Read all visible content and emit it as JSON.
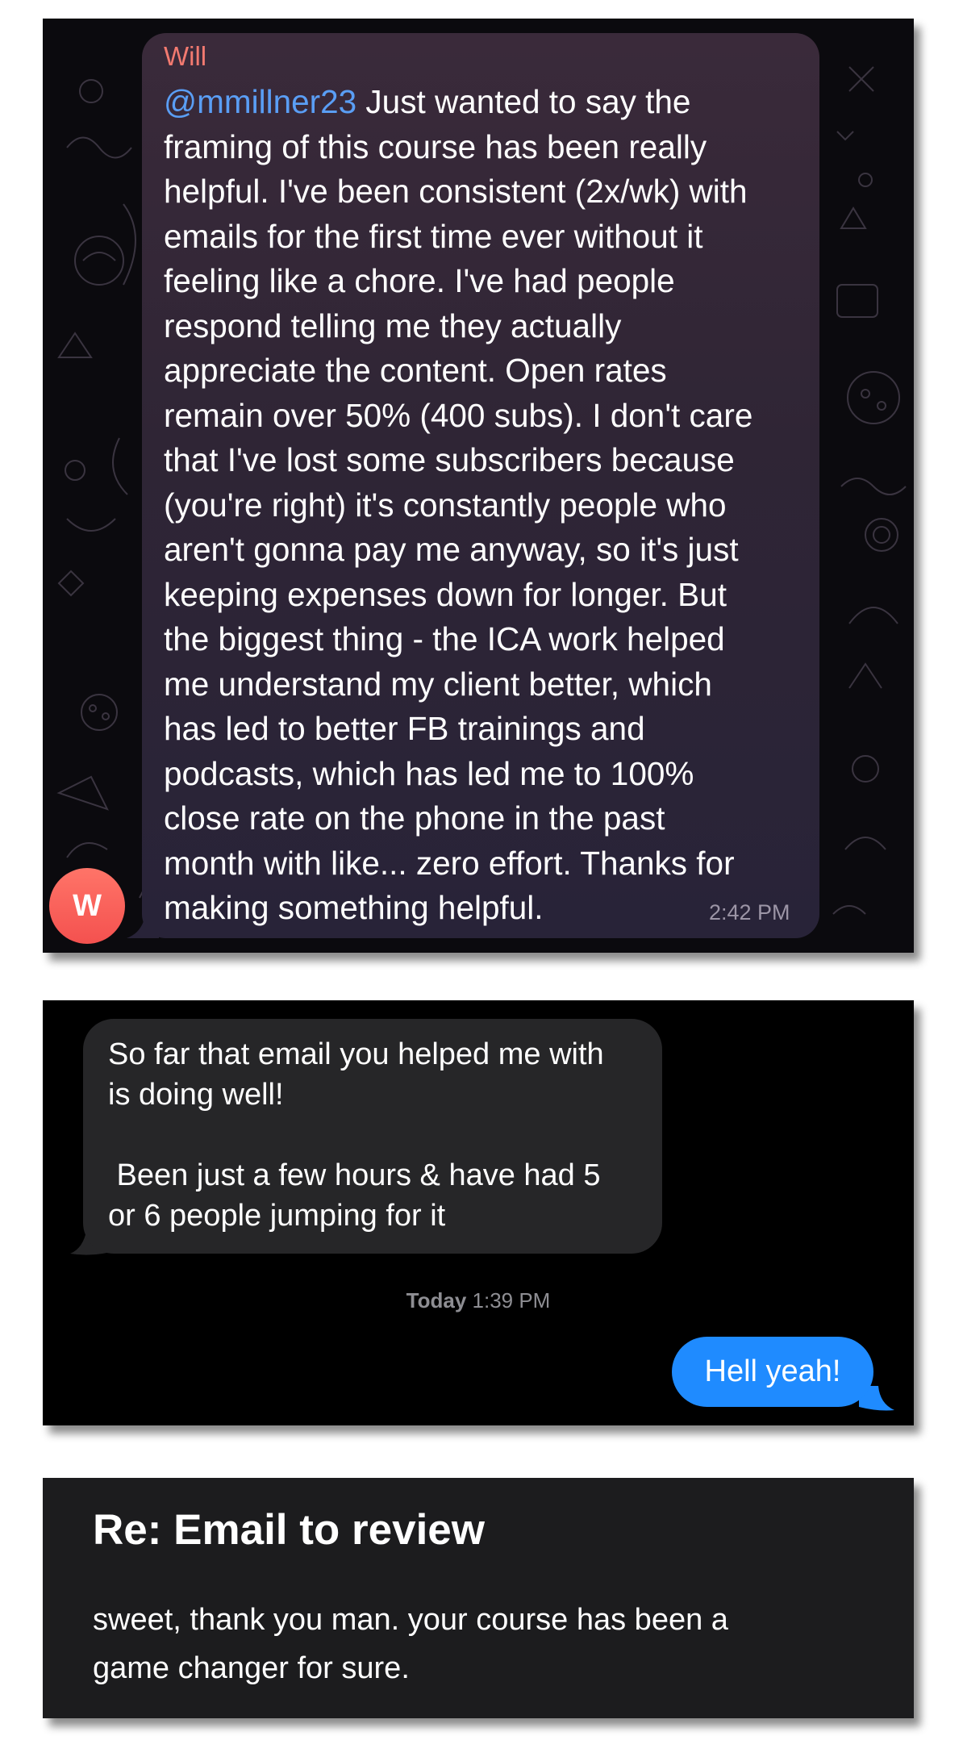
{
  "telegram": {
    "sender_name": "Will",
    "mention": "@mmillner23",
    "message_lines": [
      " Just wanted to say the",
      "framing of this course has been really",
      "helpful. I've been consistent (2x/wk) with",
      "emails for the first time ever without it",
      "feeling like a chore. I've had people",
      "respond telling me they actually",
      "appreciate the content. Open rates",
      "remain over 50% (400 subs). I don't care",
      "that I've lost some subscribers because",
      "(you're right) it's constantly people who",
      "aren't gonna pay me anyway, so it's just",
      "keeping expenses down for longer. But",
      "the biggest thing - the ICA work helped",
      "me understand my client better, which",
      "has led to better FB trainings and",
      "podcasts, which has led me to 100%",
      "close rate on the phone in the past",
      "month with like... zero effort. Thanks for",
      "making something helpful."
    ],
    "time": "2:42 PM",
    "avatar_initial": "W",
    "colors": {
      "sender": "#f27a70",
      "mention": "#5a9ef5",
      "avatar": "#f4514f"
    }
  },
  "imessage": {
    "received_lines": [
      "So far that email you helped me with",
      "is doing well!",
      "",
      " Been just a few hours & have had 5",
      "or 6 people jumping for it"
    ],
    "timestamp_day": "Today",
    "timestamp_time": "1:39 PM",
    "sent_text": "Hell yeah!",
    "colors": {
      "sent_bubble": "#1f8bff",
      "received_bubble": "#262628"
    }
  },
  "email": {
    "subject": "Re: Email to review",
    "body_lines": [
      "sweet, thank you man. your course has been a",
      "game changer for sure."
    ]
  }
}
